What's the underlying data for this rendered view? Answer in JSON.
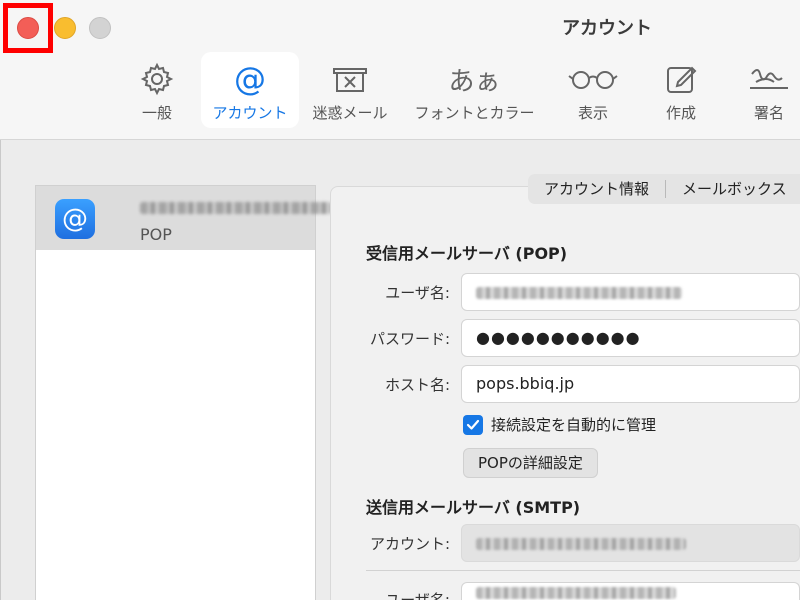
{
  "window": {
    "title": "アカウント"
  },
  "toolbar": {
    "items": [
      {
        "label": "一般",
        "icon": "gear-icon"
      },
      {
        "label": "アカウント",
        "icon": "at-sign-icon",
        "active": true
      },
      {
        "label": "迷惑メール",
        "icon": "junk-tray-icon"
      },
      {
        "label": "フォントとカラー",
        "icon": "font-icon",
        "icon_text": "あぁ"
      },
      {
        "label": "表示",
        "icon": "glasses-icon"
      },
      {
        "label": "作成",
        "icon": "compose-icon"
      },
      {
        "label": "署名",
        "icon": "signature-icon"
      }
    ]
  },
  "sidebar": {
    "account": {
      "type": "POP",
      "icon": "at-sign-icon"
    }
  },
  "tabs": {
    "account_info": "アカウント情報",
    "mailbox": "メールボックス"
  },
  "incoming": {
    "section_title": "受信用メールサーバ (POP)",
    "username_label": "ユーザ名:",
    "password_label": "パスワード:",
    "password_value": "●●●●●●●●●●●",
    "host_label": "ホスト名:",
    "host_value": "pops.bbiq.jp",
    "auto_manage_label": "接続設定を自動的に管理",
    "auto_manage_checked": true,
    "details_button": "POPの詳細設定"
  },
  "outgoing": {
    "section_title": "送信用メールサーバ (SMTP)",
    "account_label": "アカウント:",
    "username_label": "ユーザ名:"
  },
  "colors": {
    "accent": "#1677e5",
    "close": "#f35e57",
    "minimize": "#f9bd2f",
    "highlight": "#ff0000"
  }
}
